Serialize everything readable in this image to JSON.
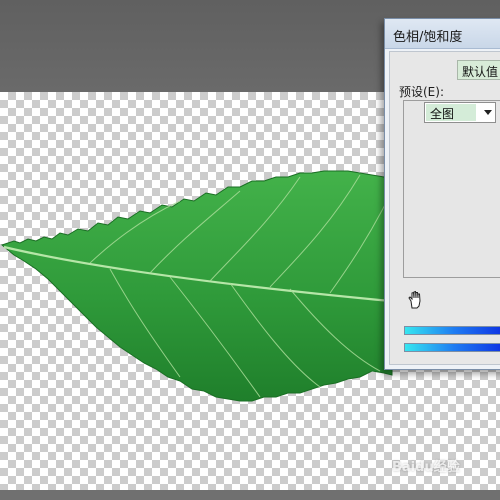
{
  "dialog": {
    "title": "色相/饱和度",
    "preset_label": "预设(E):",
    "preset_value": "默认值",
    "edit_value": "全图"
  },
  "icons": {
    "hand_tool": "hand-icon",
    "dropdown": "chevron-down-icon"
  },
  "colors": {
    "leaf_green": "#2f9a3a",
    "spectrum_start": "#36e6f0",
    "spectrum_end": "#0a22e0",
    "dialog_bg": "#eef2f7"
  },
  "watermark": {
    "text": "Baidu经验"
  }
}
